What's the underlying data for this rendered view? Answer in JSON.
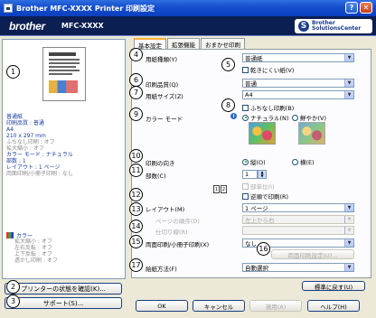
{
  "window": {
    "title": "Brother MFC-XXXX  Printer 印刷設定",
    "help": "?",
    "close": "✕"
  },
  "header": {
    "brand": "brother",
    "model": "MFC-XXXX",
    "solutions_line1": "Brother",
    "solutions_line2": "SolutionsCenter"
  },
  "summary": {
    "lines_blue": [
      "普通紙",
      "印刷品質 : 普通",
      "A4",
      "210 x 297 mm"
    ],
    "line_gray1": "ふちなし印刷 : オフ",
    "line_gray2": "拡大縮小 : オフ",
    "lines_blue2": [
      "カラー モード : ナチュラル",
      "部数 : 1",
      "レイアウト : 1 ページ"
    ],
    "line_gray3": "両面印刷/小冊子印刷 : なし",
    "color_head": "カラー",
    "color_items": [
      "拡大縮小 : オフ",
      "左右反転 : オフ",
      "上下反転 : オフ",
      "透かし印刷 : オフ"
    ]
  },
  "left_buttons": {
    "status": "プリンターの状態を確認(K)...",
    "support": "サポート(S)..."
  },
  "tabs": [
    "基本設定",
    "拡張機能",
    "おまかせ印刷"
  ],
  "form": {
    "media_label": "用紙種類(Y)",
    "media_value": "普通紙",
    "slow_dry": "乾きにくい紙(V)",
    "quality_label": "印刷品質(Q)",
    "quality_value": "普通",
    "size_label": "用紙サイズ(Z)",
    "size_value": "A4",
    "borderless": "ふちなし印刷(B)",
    "color_mode_label": "カラー モード",
    "color_natural": "ナチュラル(N)",
    "color_vivid": "鮮やか(V)",
    "orientation_label": "印刷の向き",
    "orient_portrait": "縦(O)",
    "orient_landscape": "横(E)",
    "copies_label": "部数(C)",
    "copies_value": "1",
    "collate": "部単位(I)",
    "reverse": "逆順で印刷(R)",
    "layout_label": "レイアウト(M)",
    "layout_value": "1 ページ",
    "page_order_label": "ページの順序(D)",
    "page_order_value": "左上から右",
    "border_label": "仕切り線(R)",
    "border_value": "",
    "duplex_label": "両面印刷/小冊子印刷(X)",
    "duplex_value": "なし",
    "duplex_settings": "両面印刷設定(U)...",
    "paper_source_label": "給紙方法(F)",
    "paper_source_value": "自動選択",
    "default": "標準に戻す(U)"
  },
  "bottom_buttons": {
    "ok": "OK",
    "cancel": "キャンセル",
    "apply": "適用(A)",
    "help": "ヘルプ(H)"
  },
  "callouts": [
    "1",
    "2",
    "3",
    "4",
    "5",
    "6",
    "7",
    "8",
    "9",
    "10",
    "11",
    "12",
    "13",
    "14",
    "15",
    "16",
    "17"
  ],
  "layout_icon": [
    "1",
    "2"
  ],
  "info_icon": "i",
  "colors": {
    "title_bar": "#1650d0",
    "header_bg": "#0c1f52",
    "summary_blue": "#1a3aa0",
    "tab_highlight": "#f8b038"
  }
}
